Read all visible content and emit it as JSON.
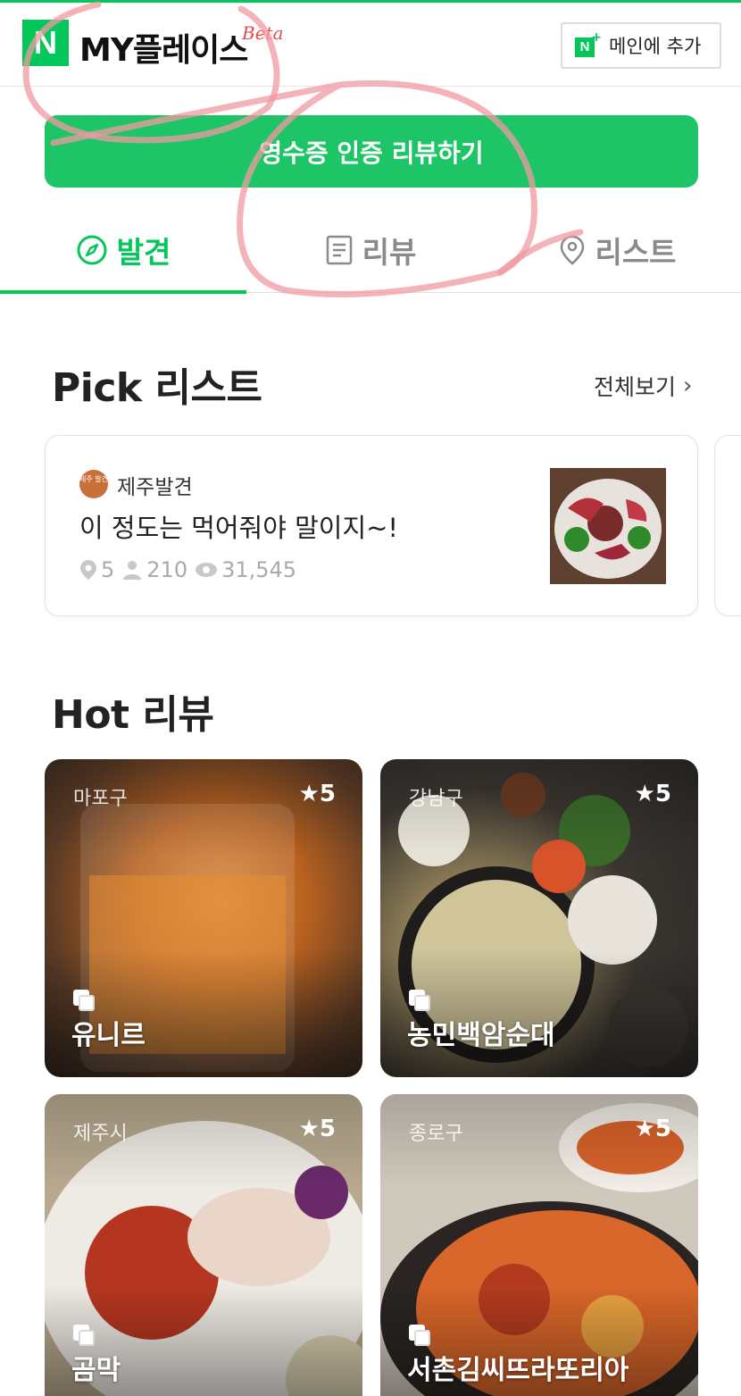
{
  "header": {
    "logo_letter": "N",
    "title": "MY플레이스",
    "beta": "Beta",
    "add_main": {
      "icon_letter": "N",
      "icon_plus": "+",
      "label": "메인에 추가"
    }
  },
  "receipt_button": {
    "label": "영수증 인증 리뷰하기"
  },
  "tabs": [
    {
      "label": "발견",
      "icon": "compass-icon",
      "active": true
    },
    {
      "label": "리뷰",
      "icon": "document-icon",
      "active": false
    },
    {
      "label": "리스트",
      "icon": "location-pin-icon",
      "active": false
    }
  ],
  "pick": {
    "title": "Pick 리스트",
    "see_all": "전체보기",
    "see_all_chevron": "›",
    "card": {
      "avatar_text": "제주\n발견",
      "author": "제주발견",
      "title": "이 정도는 먹어줘야 말이지~!",
      "places": "5",
      "followers": "210",
      "views": "31,545"
    }
  },
  "hot": {
    "title": "Hot 리뷰",
    "reviews": [
      {
        "region": "마포구",
        "rating": "★5",
        "place": "유니르"
      },
      {
        "region": "강남구",
        "rating": "★5",
        "place": "농민백암순대"
      },
      {
        "region": "제주시",
        "rating": "★5",
        "place": "곰막"
      },
      {
        "region": "종로구",
        "rating": "★5",
        "place": "서촌김씨뜨라또리아"
      }
    ]
  },
  "colors": {
    "brand": "#03c75a",
    "button": "#1ec567",
    "muted": "#8a8a8a"
  }
}
